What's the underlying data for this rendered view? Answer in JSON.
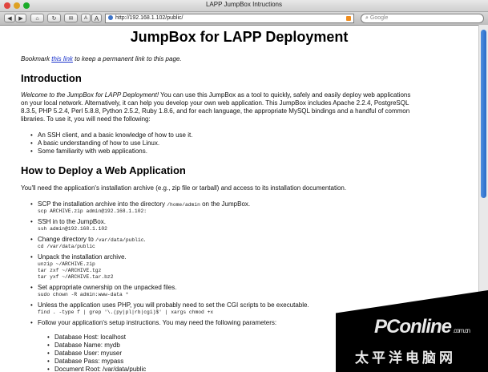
{
  "window": {
    "title": "LAPP JumpBox Intructions"
  },
  "toolbar": {
    "address": "http://192.168.1.102/public/",
    "search_placeholder": "Google",
    "text_small": "A",
    "text_large": "A"
  },
  "page": {
    "title": "JumpBox for LAPP Deployment",
    "bookmark": {
      "pre": "Bookmark ",
      "link": "this link",
      "post": " to keep a permanent link to this page."
    },
    "intro": {
      "heading": "Introduction",
      "lead_italic": "Welcome to the JumpBox for LAPP Deployment!",
      "line1": " You can use this JumpBox as a tool to quickly, safely and easily deploy web applications",
      "line2": "on your local network. Alternatively, it can help you develop your own web application. This JumpBox includes Apache 2.2.4, PostgreSQL",
      "line3": "8.3.5, PHP 5.2.4, Perl 5.8.8, Python 2.5.2, Ruby 1.8.6, and for each language, the appropriate MySQL bindings and a handful of common",
      "line4": "libraries. To use it, you will need the following:",
      "bullets": [
        "An SSH client, and a basic knowledge of how to use it.",
        "A basic understanding of how to use Linux.",
        "Some familiarity with web applications."
      ]
    },
    "deploy": {
      "heading": "How to Deploy a Web Application",
      "intro": "You'll need the application's installation archive (e.g., zip file or tarball) and access to its installation documentation.",
      "steps": [
        {
          "text": "SCP the installation archive into the directory ",
          "inline_code": "/home/admin",
          "text2": " on the JumpBox.",
          "code": "scp ARCHIVE.zip admin@192.168.1.102:"
        },
        {
          "text": "SSH in to the JumpBox.",
          "code": "ssh admin@192.168.1.102"
        },
        {
          "text": "Change directory to ",
          "inline_code": "/var/data/public",
          "text2": ".",
          "code": "cd /var/data/public"
        },
        {
          "text": "Unpack the installation archive.",
          "code": "unzip ~/ARCHIVE.zip\ntar zxf ~/ARCHIVE.tgz\ntar yxf ~/ARCHIVE.tar.bz2"
        },
        {
          "text": "Set appropriate ownership on the unpacked files.",
          "code": "sudo chown -R admin:www-data *"
        },
        {
          "text": "Unless the application uses PHP, you will probably need to set the CGI scripts to be executable.",
          "code": "find . -type f | grep '\\.(py|pl|rb|cgi)$' | xargs chmod +x"
        },
        {
          "text": "Follow your application's setup instructions. You may need the following parameters:"
        }
      ],
      "params": [
        "Database Host: localhost",
        "Database Name: mydb",
        "Database User: myuser",
        "Database Pass: mypass",
        "Document Root: /var/data/public"
      ]
    }
  },
  "watermark": {
    "brand": "PConline",
    "domain": ".com.cn",
    "chinese": "太平洋电脑网"
  },
  "colors": {
    "link": "#1a33cc",
    "scroll_thumb": "#2a6cc8"
  }
}
